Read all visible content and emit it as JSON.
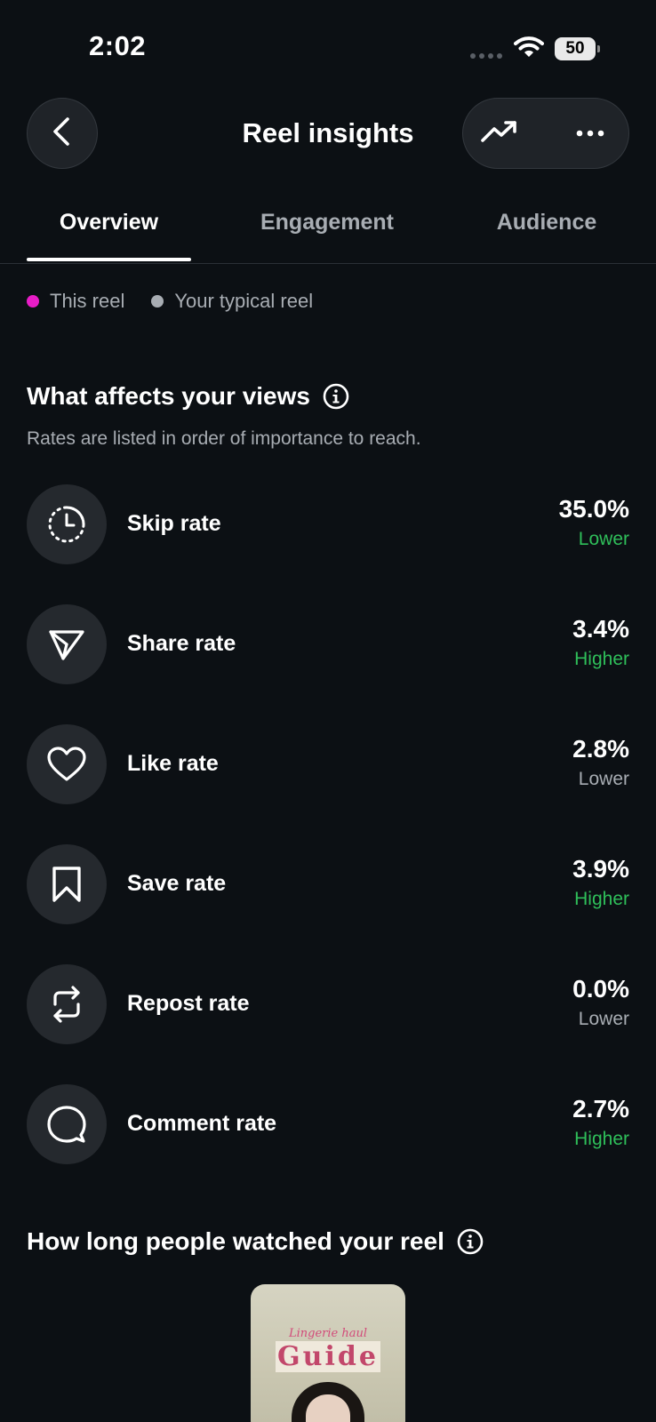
{
  "status_bar": {
    "time": "2:02",
    "battery": "50"
  },
  "header": {
    "title": "Reel insights"
  },
  "tabs": [
    {
      "label": "Overview",
      "active": true
    },
    {
      "label": "Engagement",
      "active": false
    },
    {
      "label": "Audience",
      "active": false
    }
  ],
  "legend": {
    "this_reel": {
      "label": "This reel",
      "color": "#e81dc7"
    },
    "typical_reel": {
      "label": "Your typical reel",
      "color": "#a8adb3"
    }
  },
  "views_section": {
    "title": "What affects your views",
    "subtitle": "Rates are listed in order of importance to reach.",
    "metrics": [
      {
        "label": "Skip rate",
        "value": "35.0%",
        "compare": "Lower",
        "compare_color": "#2fbf5a",
        "icon": "skip-clock-icon"
      },
      {
        "label": "Share rate",
        "value": "3.4%",
        "compare": "Higher",
        "compare_color": "#2fbf5a",
        "icon": "send-icon"
      },
      {
        "label": "Like rate",
        "value": "2.8%",
        "compare": "Lower",
        "compare_color": "#a8adb3",
        "icon": "heart-icon"
      },
      {
        "label": "Save rate",
        "value": "3.9%",
        "compare": "Higher",
        "compare_color": "#2fbf5a",
        "icon": "bookmark-icon"
      },
      {
        "label": "Repost rate",
        "value": "0.0%",
        "compare": "Lower",
        "compare_color": "#a8adb3",
        "icon": "repost-icon"
      },
      {
        "label": "Comment rate",
        "value": "2.7%",
        "compare": "Higher",
        "compare_color": "#2fbf5a",
        "icon": "comment-icon"
      }
    ]
  },
  "watch_section": {
    "title": "How long people watched your reel",
    "thumbnail": {
      "caption": "Lingerie haul",
      "word": "Guide"
    }
  }
}
